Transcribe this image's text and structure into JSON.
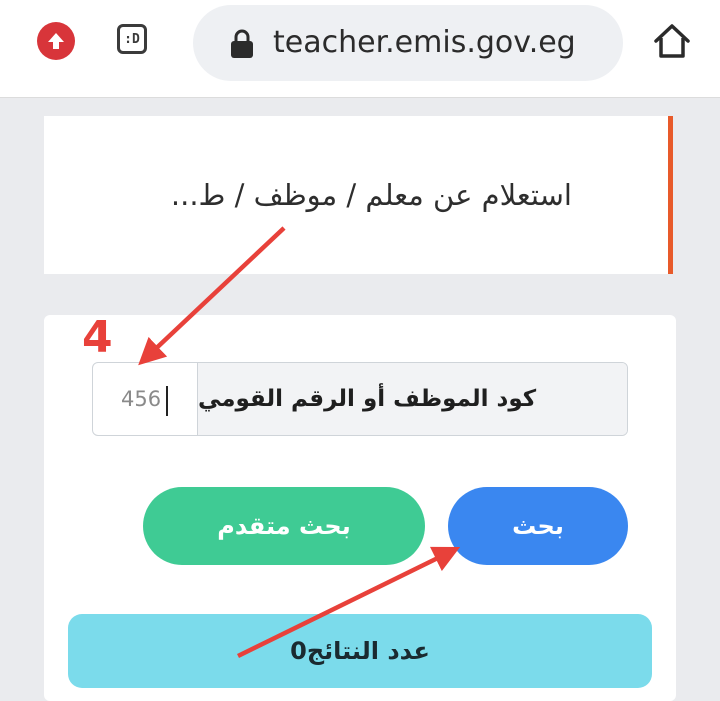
{
  "browser": {
    "url": "teacher.emis.gov.eg",
    "extension_icon": "upload-arrow-icon",
    "tabs_icon_label": ":D",
    "lock_icon": "lock-icon",
    "home_icon": "home-icon"
  },
  "page": {
    "title": "استعلام عن معلم / موظف / ط..."
  },
  "form": {
    "field_label": "كود الموظف أو الرقم القومي",
    "field_value": "456",
    "search_button": "بحث",
    "advanced_search_button": "بحث متقدم",
    "results_count": "عدد النتائج0"
  },
  "annotation": {
    "step_number": "4"
  },
  "colors": {
    "accent": "#e85a2a",
    "search_blue": "#3a87f0",
    "advanced_green": "#3fcb94",
    "results_cyan": "#7bdbeb",
    "annotation_red": "#e8413a"
  }
}
